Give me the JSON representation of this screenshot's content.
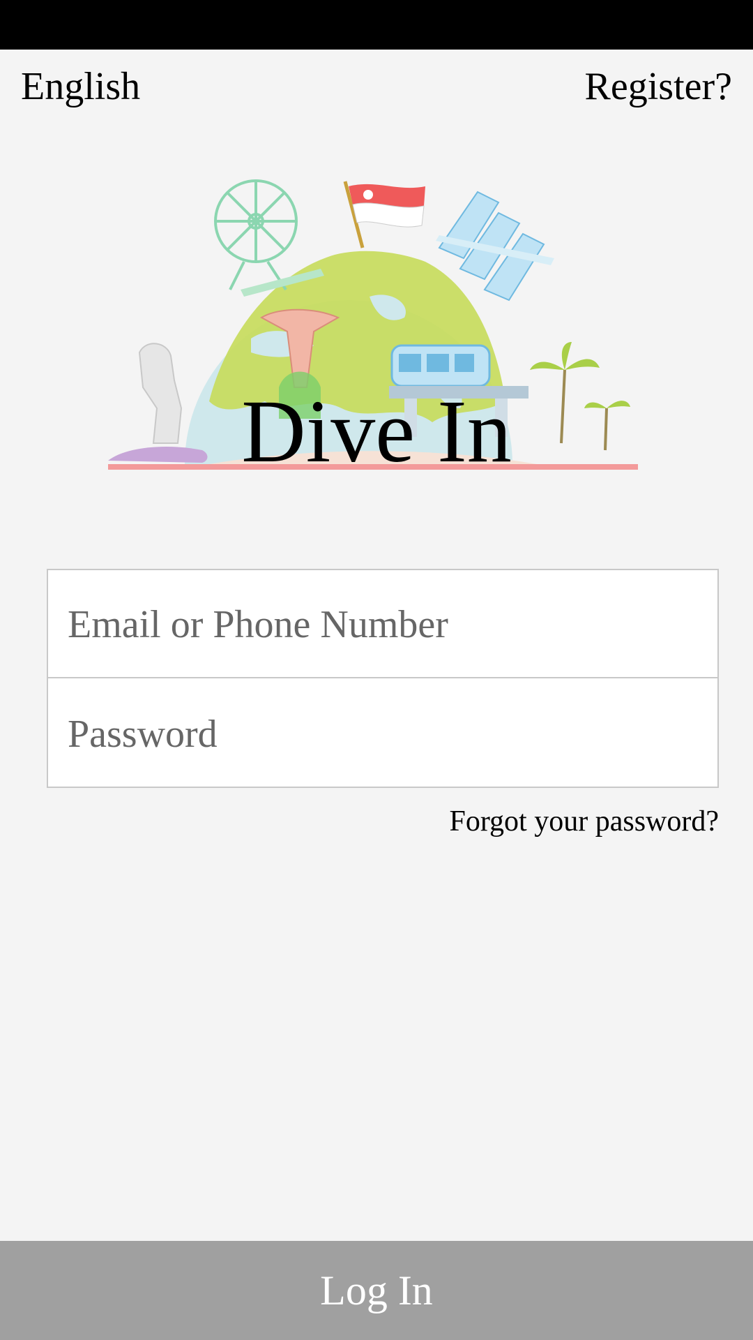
{
  "header": {
    "language_label": "English",
    "register_label": "Register?"
  },
  "hero": {
    "app_title": "Dive In",
    "illustration": "singapore-landmarks-globe"
  },
  "login_form": {
    "email_placeholder": "Email or Phone Number",
    "email_value": "",
    "password_placeholder": "Password",
    "password_value": "",
    "forgot_label": "Forgot your password?"
  },
  "footer": {
    "login_label": "Log In"
  },
  "colors": {
    "background": "#f4f4f4",
    "status_bar": "#000000",
    "login_button": "#a0a0a0",
    "login_text": "#ffffff",
    "field_border": "#c8c8c8"
  }
}
